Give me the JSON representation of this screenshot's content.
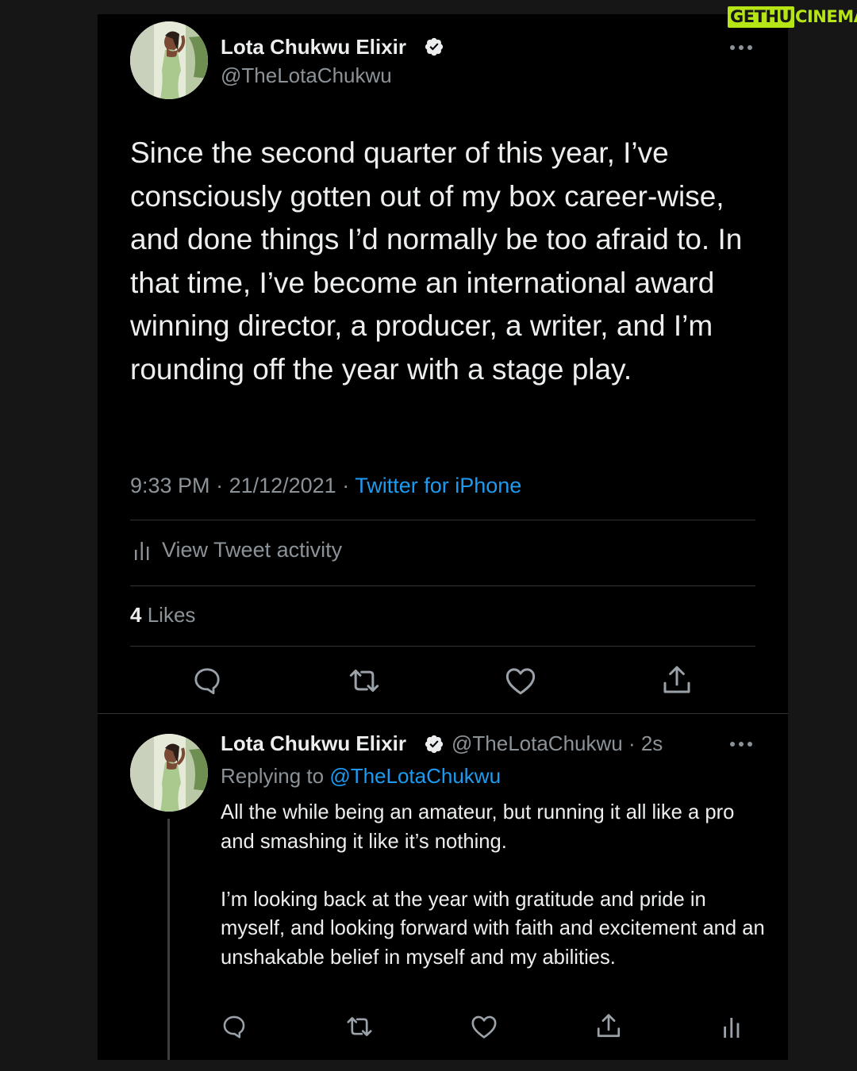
{
  "watermark": {
    "part1": "GETHU",
    "part2": "CINEMA"
  },
  "main_tweet": {
    "author_name": "Lota Chukwu Elixir",
    "author_handle": "@TheLotaChukwu",
    "text": "Since the second quarter of this year, I’ve consciously gotten out of my box career-wise, and done things I’d normally be too afraid to. In that time, I’ve become an international award winning director, a producer, a writer, and I’m rounding off the year with a stage play.",
    "time": "9:33 PM",
    "date": "21/12/2021",
    "separator": " · ",
    "source": "Twitter for iPhone",
    "activity_label": "View Tweet activity",
    "likes_count": "4",
    "likes_label": "Likes"
  },
  "reply": {
    "author_name": "Lota Chukwu Elixir",
    "author_handle_time": "@TheLotaChukwu · 2s",
    "replying_to_label": "Replying to",
    "replying_to_handle": "@TheLotaChukwu",
    "paragraph1": "All the while being an amateur, but running it all like a pro and smashing it like it’s nothing.",
    "paragraph2": "I’m looking back at the year with gratitude and pride in myself, and looking forward with faith and excitement and an unshakable belief in myself and my abilities."
  },
  "colors": {
    "accent": "#1d9bf0",
    "muted": "#8b9298",
    "watermark": "#b6e516"
  },
  "icons": [
    "reply-icon",
    "retweet-icon",
    "like-icon",
    "share-icon",
    "analytics-icon",
    "verified-icon",
    "more-icon"
  ]
}
